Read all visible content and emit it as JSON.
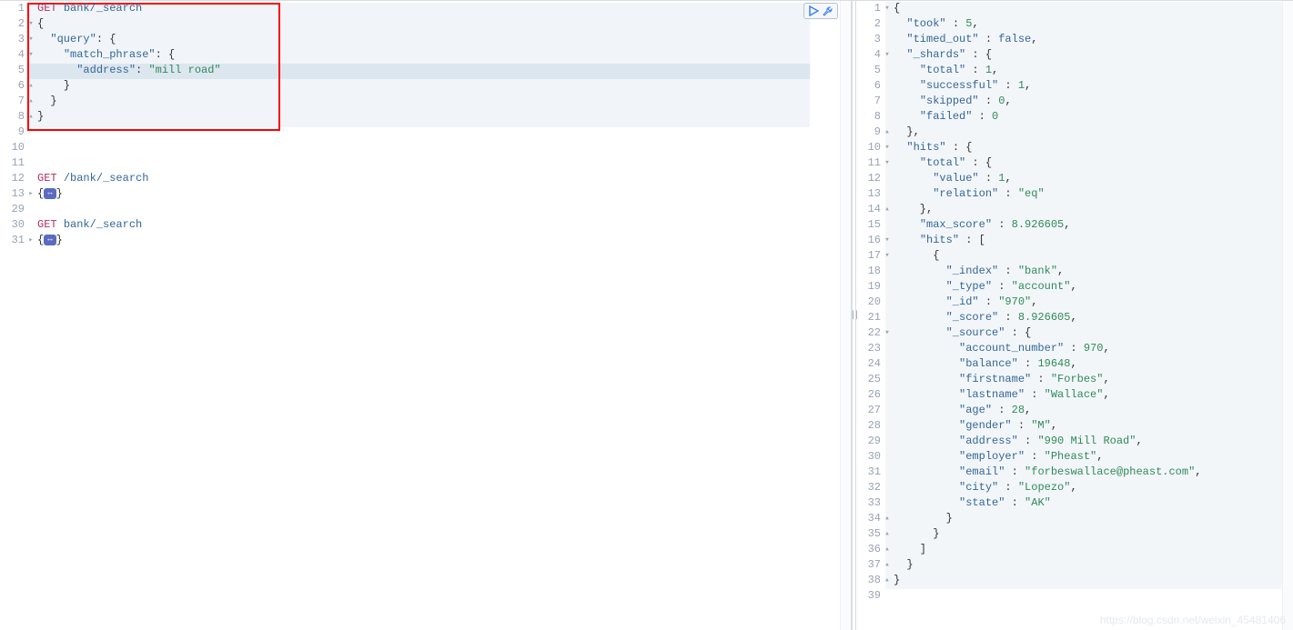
{
  "left": {
    "lines": [
      {
        "n": 1,
        "fold": "",
        "parts": [
          [
            "method",
            "GET"
          ],
          [
            "plain",
            " "
          ],
          [
            "path",
            "bank/_search"
          ]
        ]
      },
      {
        "n": 2,
        "fold": "▾",
        "parts": [
          [
            "plain",
            "{"
          ]
        ]
      },
      {
        "n": 3,
        "fold": "▾",
        "parts": [
          [
            "plain",
            "  "
          ],
          [
            "key",
            "\"query\""
          ],
          [
            "punct",
            ": {"
          ]
        ]
      },
      {
        "n": 4,
        "fold": "▾",
        "parts": [
          [
            "plain",
            "    "
          ],
          [
            "key",
            "\"match_phrase\""
          ],
          [
            "punct",
            ": {"
          ]
        ]
      },
      {
        "n": 5,
        "fold": "",
        "parts": [
          [
            "plain",
            "      "
          ],
          [
            "key",
            "\"address\""
          ],
          [
            "punct",
            ": "
          ],
          [
            "string",
            "\"mill road\""
          ]
        ],
        "current": true
      },
      {
        "n": 6,
        "fold": "▴",
        "parts": [
          [
            "plain",
            "    }"
          ]
        ]
      },
      {
        "n": 7,
        "fold": "▴",
        "parts": [
          [
            "plain",
            "  }"
          ]
        ]
      },
      {
        "n": 8,
        "fold": "▴",
        "parts": [
          [
            "plain",
            "}"
          ]
        ]
      },
      {
        "n": 9,
        "fold": "",
        "parts": []
      },
      {
        "n": 10,
        "fold": "",
        "parts": []
      },
      {
        "n": 11,
        "fold": "",
        "parts": []
      },
      {
        "n": 12,
        "fold": "",
        "parts": [
          [
            "method",
            "GET"
          ],
          [
            "plain",
            " "
          ],
          [
            "path",
            "/bank/_search"
          ]
        ]
      },
      {
        "n": 13,
        "fold": "▸",
        "parts": [
          [
            "plain",
            "{"
          ],
          [
            "badge",
            ""
          ],
          [
            "plain",
            "}"
          ]
        ]
      },
      {
        "n": 29,
        "fold": "",
        "parts": []
      },
      {
        "n": 30,
        "fold": "",
        "parts": [
          [
            "method",
            "GET"
          ],
          [
            "plain",
            " "
          ],
          [
            "path",
            "bank/_search"
          ]
        ]
      },
      {
        "n": 31,
        "fold": "▸",
        "parts": [
          [
            "plain",
            "{"
          ],
          [
            "badge",
            ""
          ],
          [
            "plain",
            "}"
          ]
        ]
      }
    ]
  },
  "right": {
    "lines": [
      {
        "n": 1,
        "fold": "▾",
        "parts": [
          [
            "punct",
            "{"
          ]
        ]
      },
      {
        "n": 2,
        "fold": "",
        "parts": [
          [
            "plain",
            "  "
          ],
          [
            "key",
            "\"took\""
          ],
          [
            "punct",
            " : "
          ],
          [
            "num-val",
            "5"
          ],
          [
            "punct",
            ","
          ]
        ]
      },
      {
        "n": 3,
        "fold": "",
        "parts": [
          [
            "plain",
            "  "
          ],
          [
            "key",
            "\"timed_out\""
          ],
          [
            "punct",
            " : "
          ],
          [
            "bool",
            "false"
          ],
          [
            "punct",
            ","
          ]
        ]
      },
      {
        "n": 4,
        "fold": "▾",
        "parts": [
          [
            "plain",
            "  "
          ],
          [
            "key",
            "\"_shards\""
          ],
          [
            "punct",
            " : {"
          ]
        ]
      },
      {
        "n": 5,
        "fold": "",
        "parts": [
          [
            "plain",
            "    "
          ],
          [
            "key",
            "\"total\""
          ],
          [
            "punct",
            " : "
          ],
          [
            "num-val",
            "1"
          ],
          [
            "punct",
            ","
          ]
        ]
      },
      {
        "n": 6,
        "fold": "",
        "parts": [
          [
            "plain",
            "    "
          ],
          [
            "key",
            "\"successful\""
          ],
          [
            "punct",
            " : "
          ],
          [
            "num-val",
            "1"
          ],
          [
            "punct",
            ","
          ]
        ]
      },
      {
        "n": 7,
        "fold": "",
        "parts": [
          [
            "plain",
            "    "
          ],
          [
            "key",
            "\"skipped\""
          ],
          [
            "punct",
            " : "
          ],
          [
            "num-val",
            "0"
          ],
          [
            "punct",
            ","
          ]
        ]
      },
      {
        "n": 8,
        "fold": "",
        "parts": [
          [
            "plain",
            "    "
          ],
          [
            "key",
            "\"failed\""
          ],
          [
            "punct",
            " : "
          ],
          [
            "num-val",
            "0"
          ]
        ]
      },
      {
        "n": 9,
        "fold": "▴",
        "parts": [
          [
            "plain",
            "  },"
          ]
        ]
      },
      {
        "n": 10,
        "fold": "▾",
        "parts": [
          [
            "plain",
            "  "
          ],
          [
            "key",
            "\"hits\""
          ],
          [
            "punct",
            " : {"
          ]
        ]
      },
      {
        "n": 11,
        "fold": "▾",
        "parts": [
          [
            "plain",
            "    "
          ],
          [
            "key",
            "\"total\""
          ],
          [
            "punct",
            " : {"
          ]
        ]
      },
      {
        "n": 12,
        "fold": "",
        "parts": [
          [
            "plain",
            "      "
          ],
          [
            "key",
            "\"value\""
          ],
          [
            "punct",
            " : "
          ],
          [
            "num-val",
            "1"
          ],
          [
            "punct",
            ","
          ]
        ]
      },
      {
        "n": 13,
        "fold": "",
        "parts": [
          [
            "plain",
            "      "
          ],
          [
            "key",
            "\"relation\""
          ],
          [
            "punct",
            " : "
          ],
          [
            "string",
            "\"eq\""
          ]
        ]
      },
      {
        "n": 14,
        "fold": "▴",
        "parts": [
          [
            "plain",
            "    },"
          ]
        ]
      },
      {
        "n": 15,
        "fold": "",
        "parts": [
          [
            "plain",
            "    "
          ],
          [
            "key",
            "\"max_score\""
          ],
          [
            "punct",
            " : "
          ],
          [
            "num-val",
            "8.926605"
          ],
          [
            "punct",
            ","
          ]
        ]
      },
      {
        "n": 16,
        "fold": "▾",
        "parts": [
          [
            "plain",
            "    "
          ],
          [
            "key",
            "\"hits\""
          ],
          [
            "punct",
            " : ["
          ]
        ]
      },
      {
        "n": 17,
        "fold": "▾",
        "parts": [
          [
            "plain",
            "      {"
          ]
        ]
      },
      {
        "n": 18,
        "fold": "",
        "parts": [
          [
            "plain",
            "        "
          ],
          [
            "key",
            "\"_index\""
          ],
          [
            "punct",
            " : "
          ],
          [
            "string",
            "\"bank\""
          ],
          [
            "punct",
            ","
          ]
        ]
      },
      {
        "n": 19,
        "fold": "",
        "parts": [
          [
            "plain",
            "        "
          ],
          [
            "key",
            "\"_type\""
          ],
          [
            "punct",
            " : "
          ],
          [
            "string",
            "\"account\""
          ],
          [
            "punct",
            ","
          ]
        ]
      },
      {
        "n": 20,
        "fold": "",
        "parts": [
          [
            "plain",
            "        "
          ],
          [
            "key",
            "\"_id\""
          ],
          [
            "punct",
            " : "
          ],
          [
            "string",
            "\"970\""
          ],
          [
            "punct",
            ","
          ]
        ]
      },
      {
        "n": 21,
        "fold": "",
        "parts": [
          [
            "plain",
            "        "
          ],
          [
            "key",
            "\"_score\""
          ],
          [
            "punct",
            " : "
          ],
          [
            "num-val",
            "8.926605"
          ],
          [
            "punct",
            ","
          ]
        ]
      },
      {
        "n": 22,
        "fold": "▾",
        "parts": [
          [
            "plain",
            "        "
          ],
          [
            "key",
            "\"_source\""
          ],
          [
            "punct",
            " : {"
          ]
        ]
      },
      {
        "n": 23,
        "fold": "",
        "parts": [
          [
            "plain",
            "          "
          ],
          [
            "key",
            "\"account_number\""
          ],
          [
            "punct",
            " : "
          ],
          [
            "num-val",
            "970"
          ],
          [
            "punct",
            ","
          ]
        ]
      },
      {
        "n": 24,
        "fold": "",
        "parts": [
          [
            "plain",
            "          "
          ],
          [
            "key",
            "\"balance\""
          ],
          [
            "punct",
            " : "
          ],
          [
            "num-val",
            "19648"
          ],
          [
            "punct",
            ","
          ]
        ]
      },
      {
        "n": 25,
        "fold": "",
        "parts": [
          [
            "plain",
            "          "
          ],
          [
            "key",
            "\"firstname\""
          ],
          [
            "punct",
            " : "
          ],
          [
            "string",
            "\"Forbes\""
          ],
          [
            "punct",
            ","
          ]
        ]
      },
      {
        "n": 26,
        "fold": "",
        "parts": [
          [
            "plain",
            "          "
          ],
          [
            "key",
            "\"lastname\""
          ],
          [
            "punct",
            " : "
          ],
          [
            "string",
            "\"Wallace\""
          ],
          [
            "punct",
            ","
          ]
        ]
      },
      {
        "n": 27,
        "fold": "",
        "parts": [
          [
            "plain",
            "          "
          ],
          [
            "key",
            "\"age\""
          ],
          [
            "punct",
            " : "
          ],
          [
            "num-val",
            "28"
          ],
          [
            "punct",
            ","
          ]
        ]
      },
      {
        "n": 28,
        "fold": "",
        "parts": [
          [
            "plain",
            "          "
          ],
          [
            "key",
            "\"gender\""
          ],
          [
            "punct",
            " : "
          ],
          [
            "string",
            "\"M\""
          ],
          [
            "punct",
            ","
          ]
        ]
      },
      {
        "n": 29,
        "fold": "",
        "parts": [
          [
            "plain",
            "          "
          ],
          [
            "key",
            "\"address\""
          ],
          [
            "punct",
            " : "
          ],
          [
            "string",
            "\"990 Mill Road\""
          ],
          [
            "punct",
            ","
          ]
        ]
      },
      {
        "n": 30,
        "fold": "",
        "parts": [
          [
            "plain",
            "          "
          ],
          [
            "key",
            "\"employer\""
          ],
          [
            "punct",
            " : "
          ],
          [
            "string",
            "\"Pheast\""
          ],
          [
            "punct",
            ","
          ]
        ]
      },
      {
        "n": 31,
        "fold": "",
        "parts": [
          [
            "plain",
            "          "
          ],
          [
            "key",
            "\"email\""
          ],
          [
            "punct",
            " : "
          ],
          [
            "string",
            "\"forbeswallace@pheast.com\""
          ],
          [
            "punct",
            ","
          ]
        ]
      },
      {
        "n": 32,
        "fold": "",
        "parts": [
          [
            "plain",
            "          "
          ],
          [
            "key",
            "\"city\""
          ],
          [
            "punct",
            " : "
          ],
          [
            "string",
            "\"Lopezo\""
          ],
          [
            "punct",
            ","
          ]
        ]
      },
      {
        "n": 33,
        "fold": "",
        "parts": [
          [
            "plain",
            "          "
          ],
          [
            "key",
            "\"state\""
          ],
          [
            "punct",
            " : "
          ],
          [
            "string",
            "\"AK\""
          ]
        ]
      },
      {
        "n": 34,
        "fold": "▴",
        "parts": [
          [
            "plain",
            "        }"
          ]
        ]
      },
      {
        "n": 35,
        "fold": "▴",
        "parts": [
          [
            "plain",
            "      }"
          ]
        ]
      },
      {
        "n": 36,
        "fold": "▴",
        "parts": [
          [
            "plain",
            "    ]"
          ]
        ]
      },
      {
        "n": 37,
        "fold": "▴",
        "parts": [
          [
            "plain",
            "  }"
          ]
        ]
      },
      {
        "n": 38,
        "fold": "▴",
        "parts": [
          [
            "plain",
            "}"
          ]
        ]
      },
      {
        "n": 39,
        "fold": "",
        "parts": []
      }
    ]
  },
  "watermark": "https://blog.csdn.net/weixin_45481406"
}
